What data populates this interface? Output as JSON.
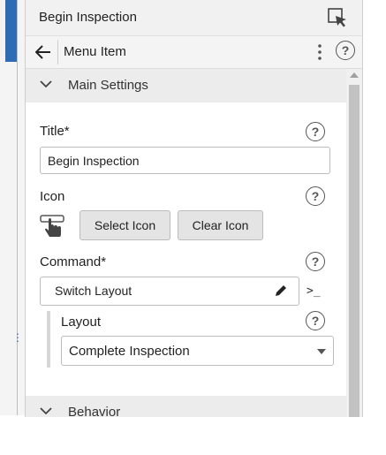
{
  "panel": {
    "title": "Begin Inspection",
    "title_icon": "pointer-select-icon"
  },
  "nav": {
    "back_icon": "arrow-left-icon",
    "title": "Menu Item",
    "more_icon": "kebab-icon",
    "help": "?"
  },
  "sections": {
    "main_settings": "Main Settings",
    "behavior": "Behavior"
  },
  "fields": {
    "title_label": "Title*",
    "title_value": "Begin Inspection",
    "icon_label": "Icon",
    "select_icon": "Select Icon",
    "clear_icon": "Clear Icon",
    "command_label": "Command*",
    "command_value": "Switch Layout",
    "terminal_symbol": ">_",
    "layout_label": "Layout",
    "layout_value": "Complete Inspection"
  },
  "help_text": "?"
}
